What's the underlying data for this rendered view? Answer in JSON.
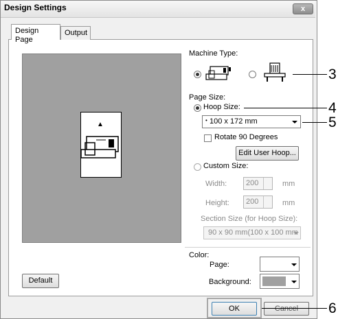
{
  "window": {
    "title": "Design Settings",
    "close_label": "x"
  },
  "tabs": [
    {
      "label": "Design Page",
      "active": true
    },
    {
      "label": "Output",
      "active": false
    }
  ],
  "machine_type": {
    "label": "Machine Type:",
    "options": [
      "embroidery-machine-icon",
      "multi-needle-machine-icon"
    ],
    "selected": 0
  },
  "page_size": {
    "label": "Page Size:",
    "hoop_size_label": "Hoop Size:",
    "hoop_size_value": "100 x 172 mm",
    "rotate_label": "Rotate 90 Degrees",
    "edit_user_hoop_label": "Edit User Hoop...",
    "custom_size_label": "Custom Size:",
    "width_label": "Width:",
    "width_value": "200",
    "width_unit": "mm",
    "height_label": "Height:",
    "height_value": "200",
    "height_unit": "mm",
    "section_label": "Section Size (for Hoop Size):",
    "section_value": "90 x  90 mm(100 x 100 mm"
  },
  "color": {
    "label": "Color:",
    "page_label": "Page:",
    "page_color": "#ffffff",
    "background_label": "Background:",
    "background_color": "#a0a0a0"
  },
  "buttons": {
    "default_label": "Default",
    "ok_label": "OK",
    "cancel_label": "Cancel"
  },
  "callouts": [
    "3",
    "4",
    "5",
    "6"
  ],
  "preview": {
    "up_arrow": "▲"
  }
}
